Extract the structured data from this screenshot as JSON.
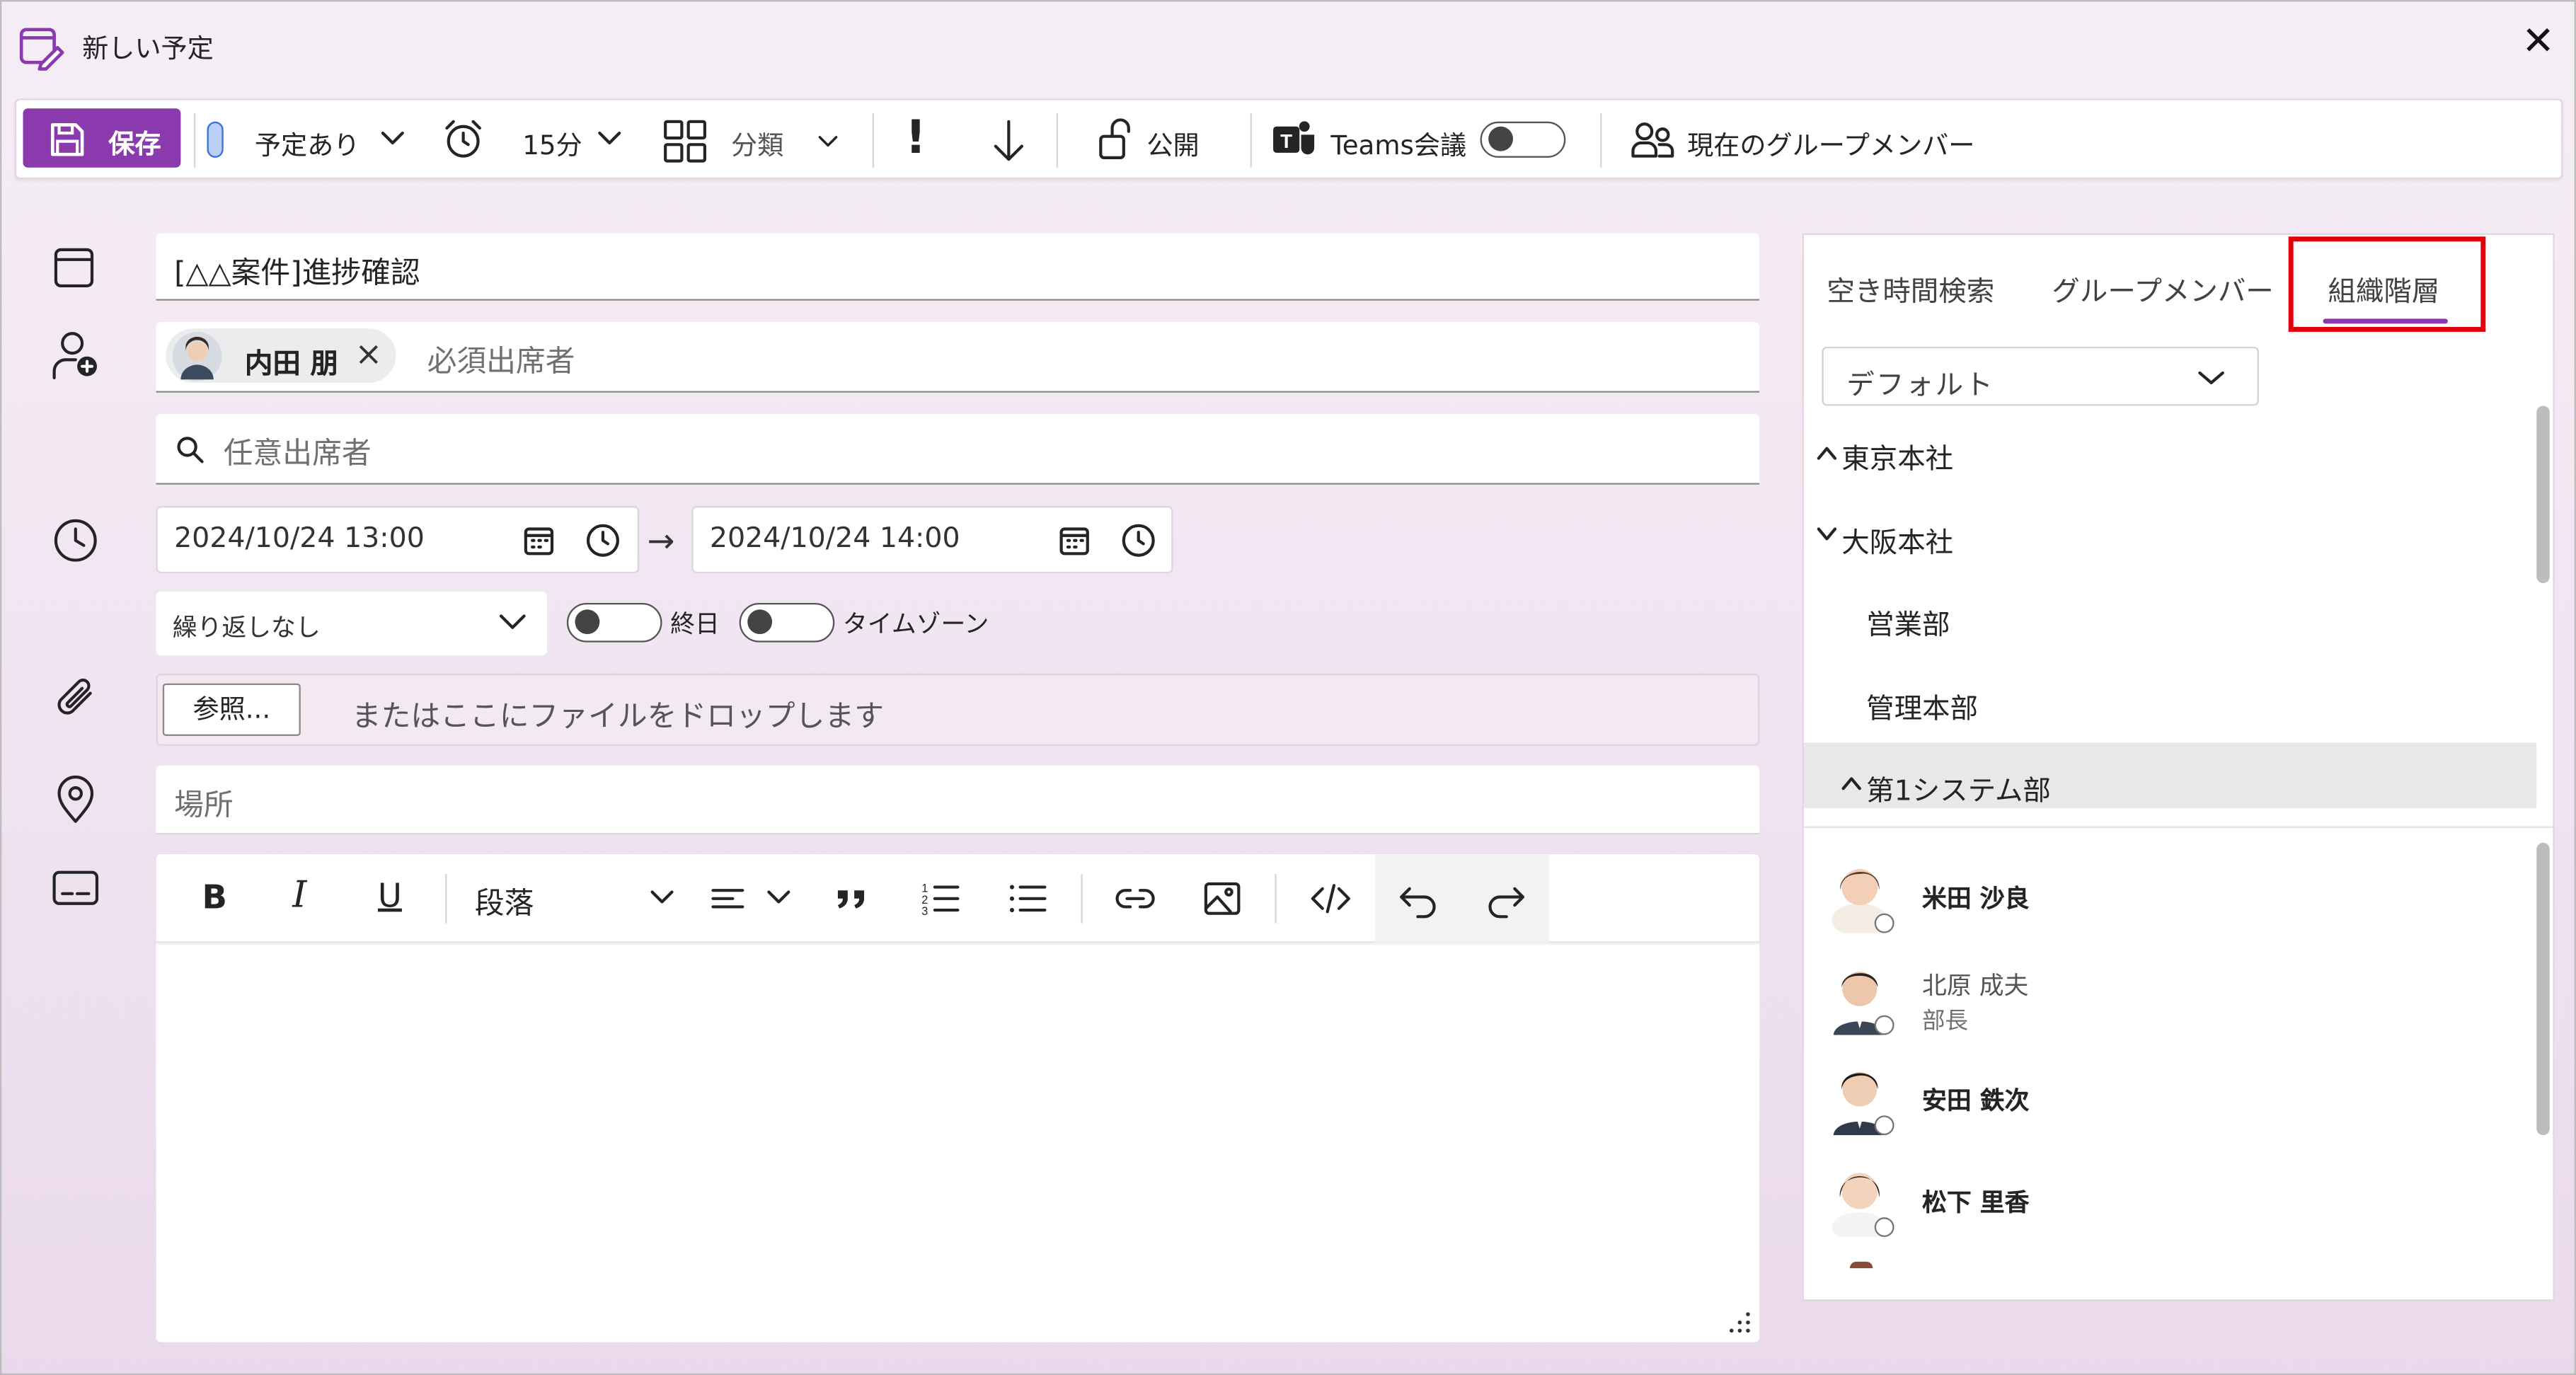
{
  "window": {
    "title": "新しい予定",
    "close_glyph": "✕"
  },
  "toolbar": {
    "save_label": "保存",
    "show_as": "予定あり",
    "reminder": "15分",
    "category": "分類",
    "importance_high_glyph": "!",
    "publish_label": "公開",
    "teams_label": "Teams会議",
    "group_members_label": "現在のグループメンバー"
  },
  "form": {
    "title_value": "[△△案件]進捗確認",
    "required_attendee": {
      "name": "内田 朋",
      "remove_glyph": "×"
    },
    "required_placeholder": "必須出席者",
    "optional_placeholder": "任意出席者",
    "start_datetime": "2024/10/24 13:00",
    "end_datetime": "2024/10/24 14:00",
    "arrow_glyph": "→",
    "repeat": "繰り返しなし",
    "all_day_label": "終日",
    "timezone_label": "タイムゾーン",
    "browse_label": "参照...",
    "drop_text": "またはここにファイルをドロップします",
    "location_placeholder": "場所"
  },
  "editor": {
    "bold": "B",
    "italic": "I",
    "underline": "U",
    "paragraph_style": "段落"
  },
  "side_panel": {
    "tabs": [
      {
        "label": "空き時間検索",
        "active": false
      },
      {
        "label": "グループメンバー",
        "active": false
      },
      {
        "label": "組織階層",
        "active": true
      }
    ],
    "org_select": "デフォルト",
    "tree": [
      {
        "label": "東京本社",
        "expanded": true
      },
      {
        "label": "大阪本社",
        "expanded": false
      },
      {
        "label": "営業部"
      },
      {
        "label": "管理本部"
      },
      {
        "label": "第1システム部",
        "expanded": true,
        "selected": true
      }
    ],
    "people": [
      {
        "name": "米田 沙良",
        "title": ""
      },
      {
        "name": "北原 成夫",
        "title": "部長"
      },
      {
        "name": "安田 鉄次",
        "title": ""
      },
      {
        "name": "松下 里香",
        "title": ""
      }
    ]
  },
  "colors": {
    "accent": "#8a3aad",
    "highlight_box": "#e3000b",
    "teams_toggle_off": "#444444"
  }
}
